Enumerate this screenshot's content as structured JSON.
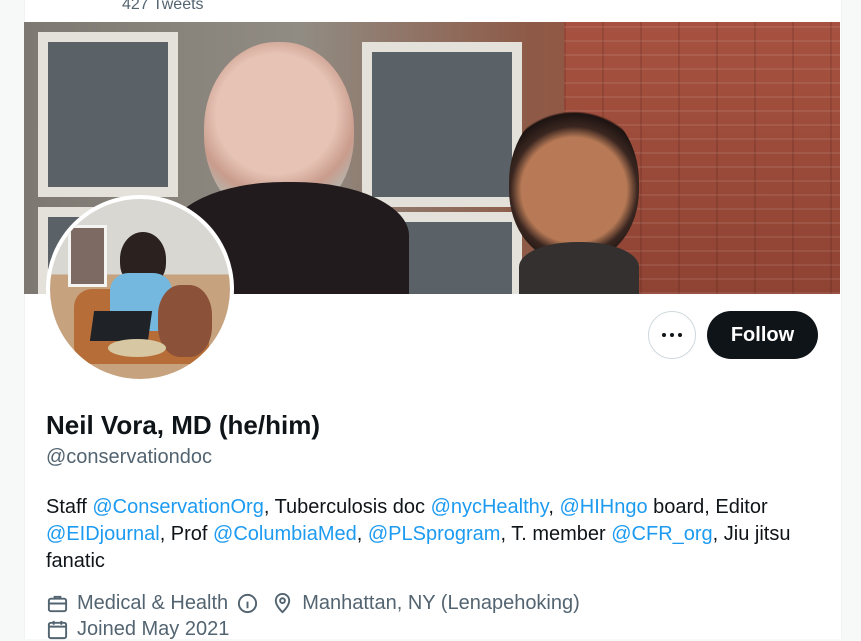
{
  "header": {
    "tweet_count": "427 Tweets"
  },
  "profile": {
    "name": "Neil Vora, MD (he/him)",
    "handle": "@conservationdoc",
    "follow_label": "Follow",
    "bio": {
      "p1": "Staff ",
      "m1": "@ConservationOrg",
      "p2": ", Tuberculosis doc ",
      "m2": "@nycHealthy",
      "p3": ", ",
      "m3": "@HIHngo",
      "p4": " board, Editor ",
      "m4": "@EIDjournal",
      "p5": ", Prof ",
      "m5": "@ColumbiaMed",
      "p6": ", ",
      "m6": "@PLSprogram",
      "p7": ", T. member ",
      "m7": "@CFR_org",
      "p8": ", Jiu jitsu fanatic"
    },
    "category": "Medical & Health",
    "location": "Manhattan, NY (Lenapehoking)",
    "joined": "Joined May 2021"
  },
  "icons": {
    "category": "briefcase-icon",
    "info": "info-icon",
    "location": "location-pin-icon",
    "calendar": "calendar-icon",
    "more": "more-horizontal-icon"
  },
  "colors": {
    "accent": "#1d9bf0",
    "text": "#0f1419",
    "secondary": "#536471",
    "button": "#0f1419"
  }
}
